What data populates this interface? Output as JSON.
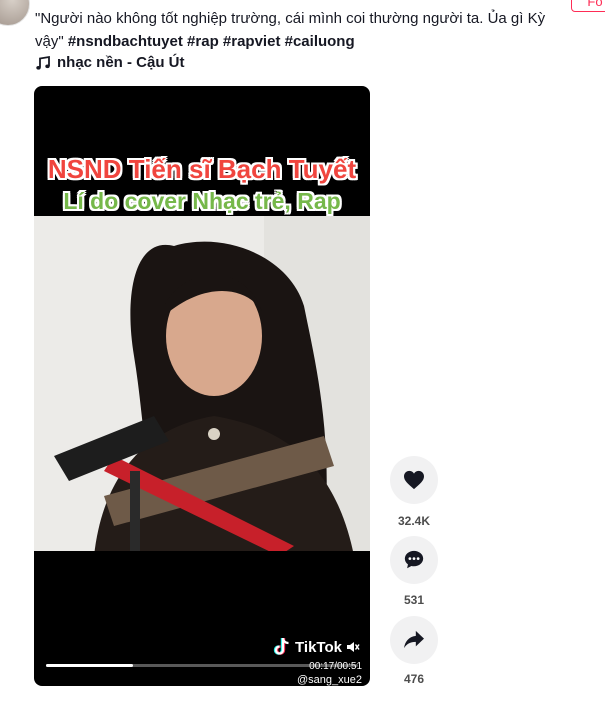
{
  "post": {
    "caption_text": "\"Người nào không tốt nghiệp trường, cái mình coi thường người ta. Ủa gì Kỳ vậy\"",
    "hashtags": [
      "#nsndbachtuyet",
      "#rap",
      "#rapviet",
      "#cailuong"
    ],
    "music_label": "nhạc nền - Cậu Út",
    "follow_label": "Fo"
  },
  "video": {
    "title_line1": "NSND Tiến sĩ Bạch Tuyết",
    "title_line2": "Lí do cover Nhạc trẻ, Rap",
    "watermark": "TikTok",
    "time": "00:17/00:51",
    "username": "@sang_xue2",
    "progress": 0.28
  },
  "actions": {
    "likes": "32.4K",
    "comments": "531",
    "shares": "476"
  },
  "colors": {
    "accent": "#fe2c55",
    "title1": "#f0453e",
    "title2": "#76b84a"
  }
}
